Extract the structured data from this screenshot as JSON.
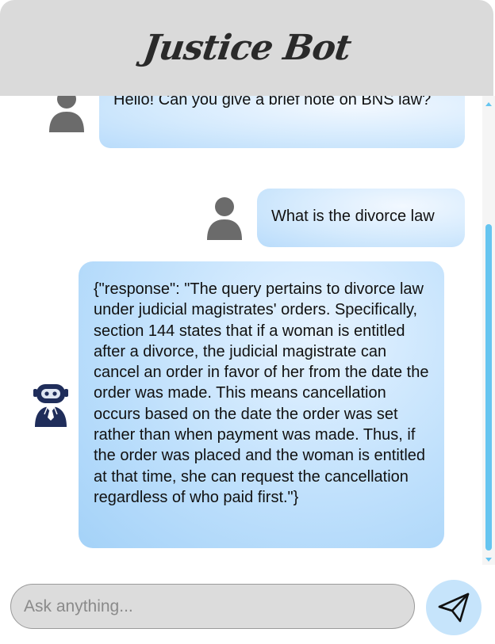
{
  "app": {
    "title": "Justice Bot"
  },
  "messages": [
    {
      "sender": "user",
      "text": "Hello! Can you give a brief note on BNS law?"
    },
    {
      "sender": "user",
      "text": "What is the divorce law"
    },
    {
      "sender": "bot",
      "text": "{\"response\": \"The query pertains to divorce law under judicial magistrates' orders. Specifically, section 144 states that if a woman is entitled after a divorce, the judicial magistrate can cancel an order in favor of her from the date the order was made. This means cancellation occurs based on the date the order was set rather than when payment was made. Thus, if the order was placed and the woman is entitled at that time, she can request the cancellation regardless of who paid first.\"}"
    }
  ],
  "input": {
    "placeholder": "Ask anything...",
    "value": ""
  },
  "icons": {
    "user_avatar": "user-avatar-icon",
    "bot_avatar": "robot-lawyer-icon",
    "send": "paper-plane-icon"
  },
  "colors": {
    "header_bg": "#dadada",
    "bubble_light": "#d4eafd",
    "bubble_bot": "#bfe0fc",
    "accent": "#66c5f0",
    "send_bg": "#c6e4fb",
    "avatar_gray": "#6b6b6b",
    "bot_navy": "#1f2d5a"
  }
}
